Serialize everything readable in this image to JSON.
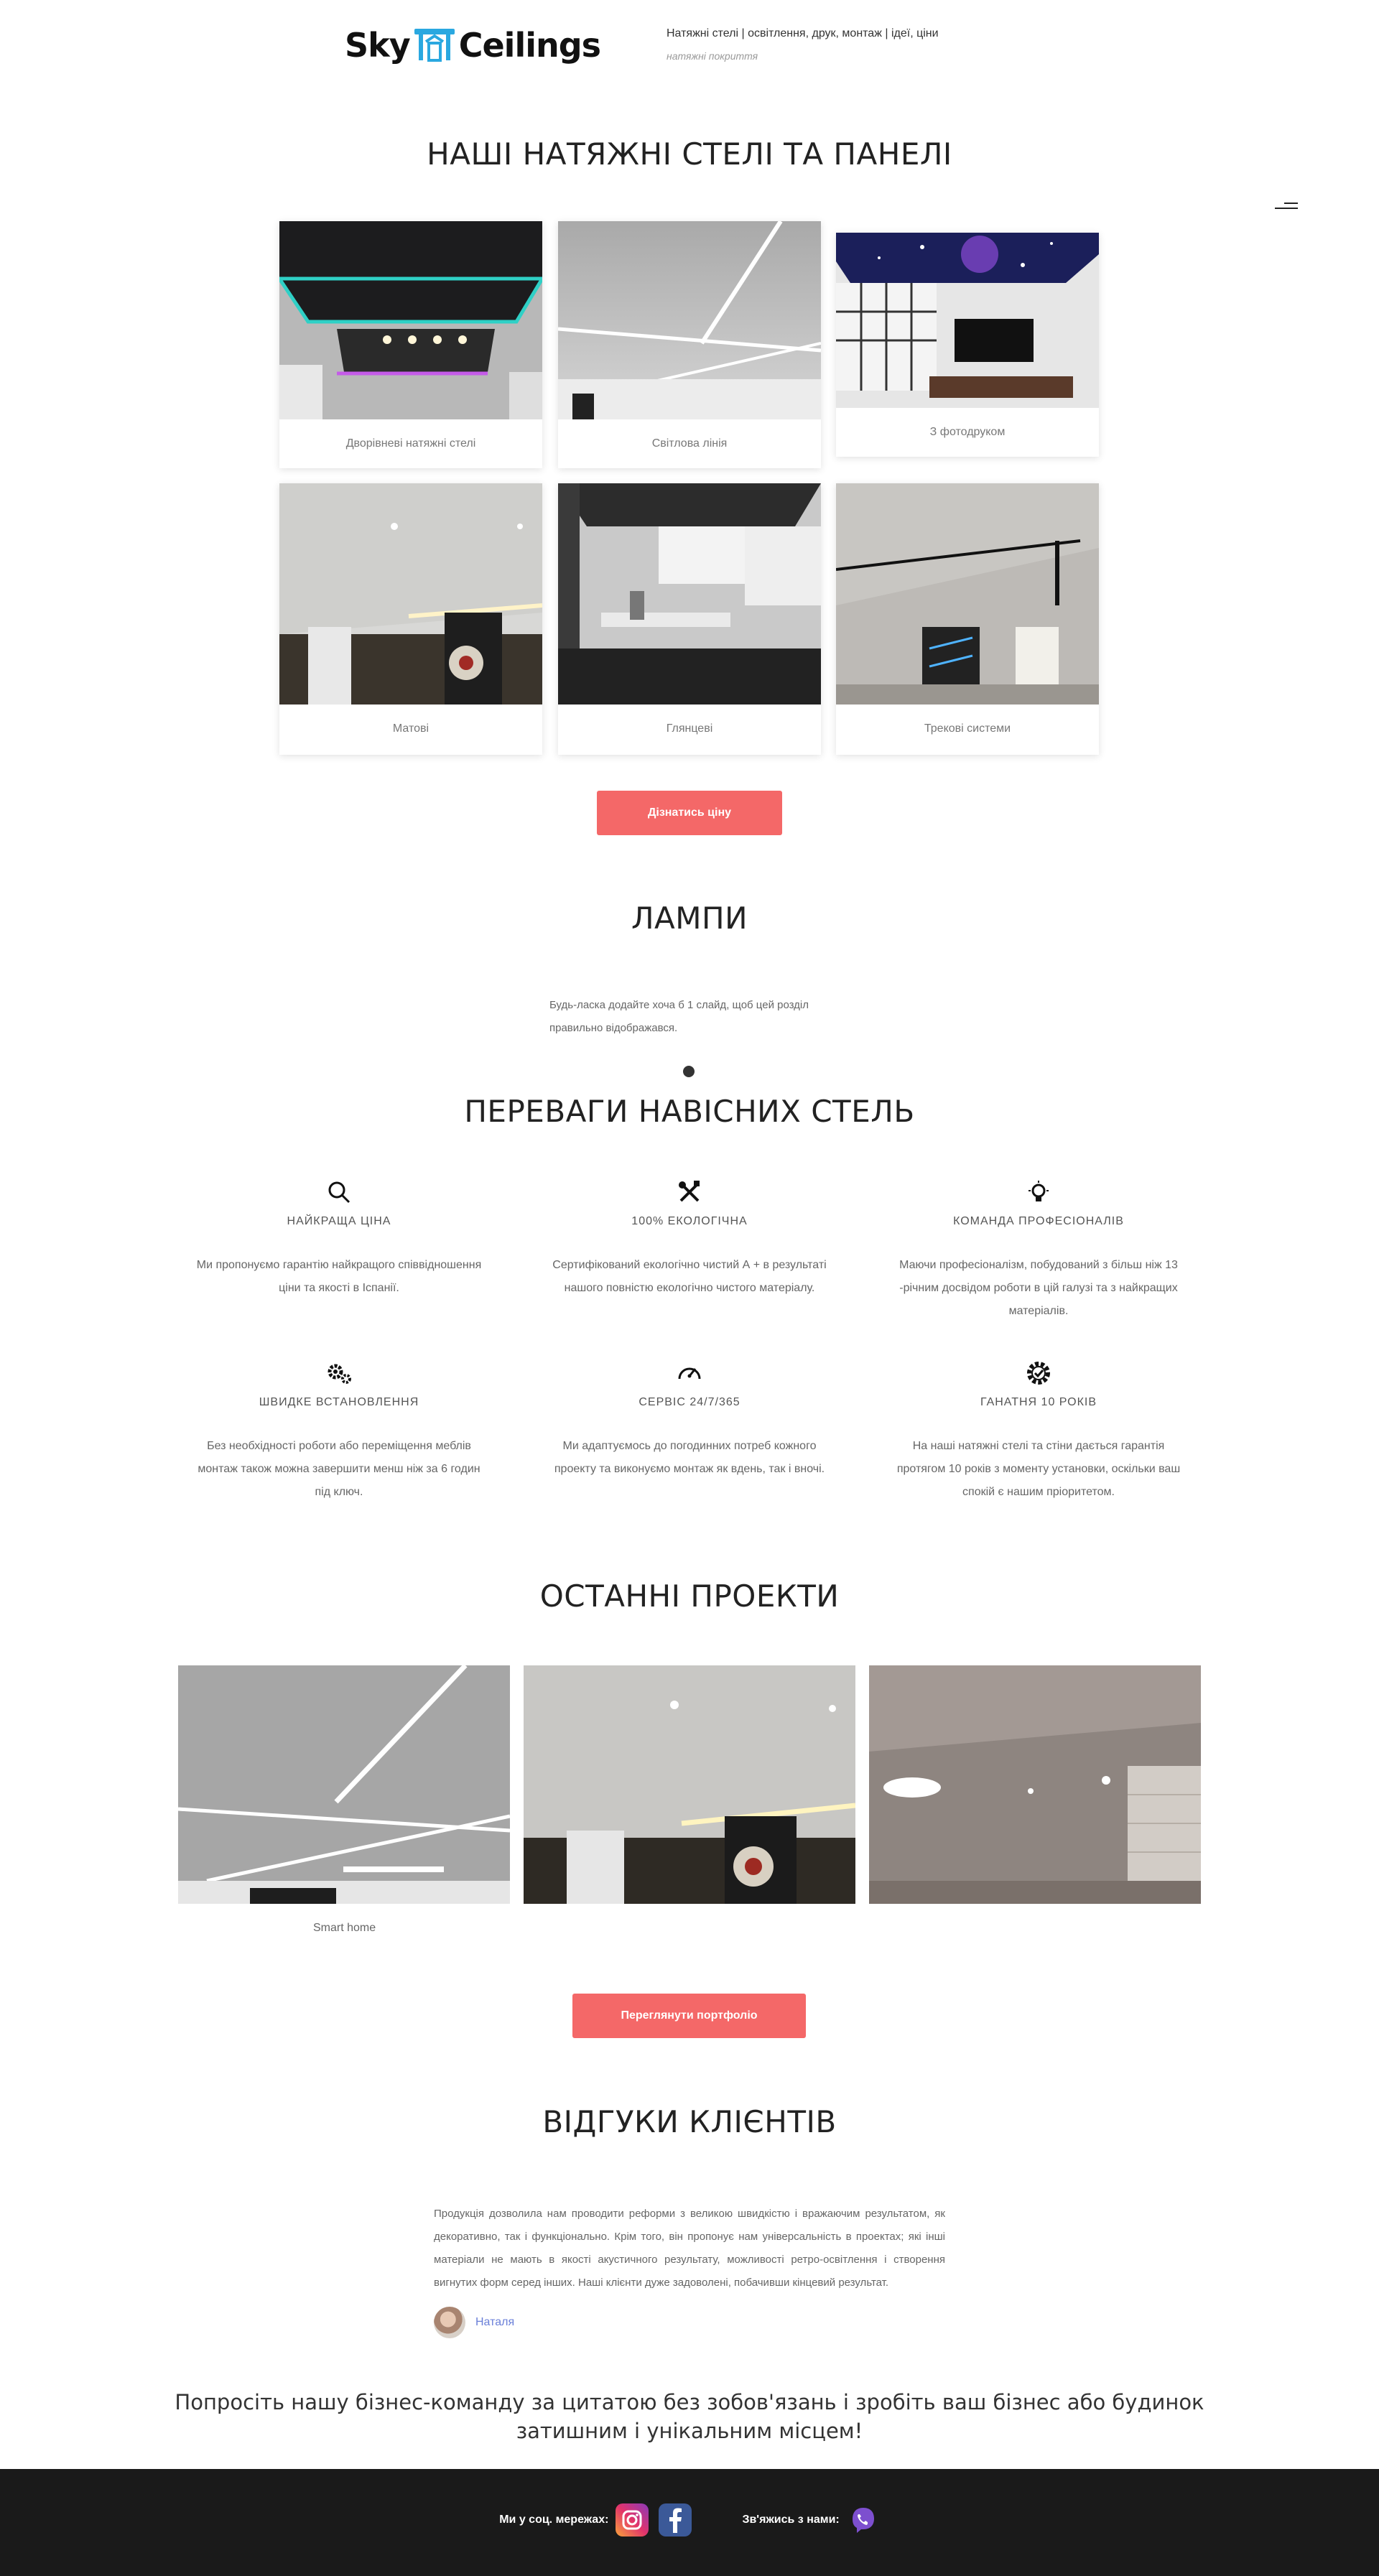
{
  "header": {
    "logo_left": "Sky",
    "logo_right": "Ceilings",
    "tagline": "Натяжні стелі | освітлення, друк, монтаж | ідеї, ціни",
    "tagline_sub": "натяжні покриття"
  },
  "products": {
    "title": "НАШІ НАТЯЖНІ СТЕЛІ ТА ПАНЕЛІ",
    "items": [
      {
        "label": "Дворівневі натяжні стелі"
      },
      {
        "label": "Світлова лінія"
      },
      {
        "label": "З фотодруком"
      },
      {
        "label": "Матові"
      },
      {
        "label": "Глянцеві"
      },
      {
        "label": "Трекові системи"
      }
    ],
    "button": "Дізнатись ціну"
  },
  "lamps": {
    "title": "ЛАМПИ",
    "note": "Будь-ласка додайте хоча б 1 слайд, щоб цей розділ правильно відображався."
  },
  "advantages": {
    "title": "ПЕРЕВАГИ НАВІСНИХ СТЕЛЬ",
    "items": [
      {
        "icon": "search-icon",
        "title": "НАЙКРАЩА ЦІНА",
        "text": "Ми пропонуємо гарантію найкращого співвідношення ціни та якості в Іспанії."
      },
      {
        "icon": "tools-icon",
        "title": "100% ЕКОЛОГІЧНА",
        "text": "Сертифікований екологічно чистий А + в результаті нашого повністю екологічно чистого матеріалу."
      },
      {
        "icon": "lightbulb-icon",
        "title": "КОМАНДА ПРОФЕСІОНАЛІВ",
        "text": "Маючи професіоналізм, побудований з більш ніж 13 -річним досвідом роботи в цій галузі та з найкращих матеріалів."
      },
      {
        "icon": "gears-icon",
        "title": "ШВИДКЕ ВСТАНОВЛЕННЯ",
        "text": "Без необхідності роботи або переміщення меблів монтаж також можна завершити менш ніж за 6 годин під ключ."
      },
      {
        "icon": "speedometer-icon",
        "title": "СЕРВІС 24/7/365",
        "text": "Ми адаптуємось до погодинних потреб кожного проекту та виконуємо монтаж як вдень, так і вночі."
      },
      {
        "icon": "badge-check-icon",
        "title": "ГАНАТНЯ 10 РОКІВ",
        "text": "На наші натяжні стелі та стіни дається гарантія протягом 10 років з моменту установки, оскільки ваш спокій є нашим пріоритетом."
      }
    ]
  },
  "projects": {
    "title": "ОСТАННІ ПРОЕКТИ",
    "caption": "Smart home",
    "button": "Переглянути портфоліо"
  },
  "reviews": {
    "title": "ВІДГУКИ КЛІЄНТІВ",
    "text": "Продукція дозволила нам проводити реформи з великою швидкістю і вражаючим результатом, як декоративно, так і функціонально. Крім того, він пропонує нам універсальність в проектах; які інші матеріали не мають в якості акустичного результату, можливості ретро-освітлення і створення вигнутих форм серед інших. Наші клієнти дуже задоволені, побачивши кінцевий результат.",
    "author": "Наталя"
  },
  "cta": "Попросіть нашу бізнес-команду за цитатою без зобов'язань і зробіть ваш бізнес або будинок затишним і унікальним місцем!",
  "footer": {
    "social_label": "Ми у соц. мережах:",
    "contact_label": "Зв'яжись з нами:"
  },
  "colors": {
    "accent": "#f46868",
    "footer_bg": "#1a1a1a",
    "link": "#6a7fd8"
  }
}
